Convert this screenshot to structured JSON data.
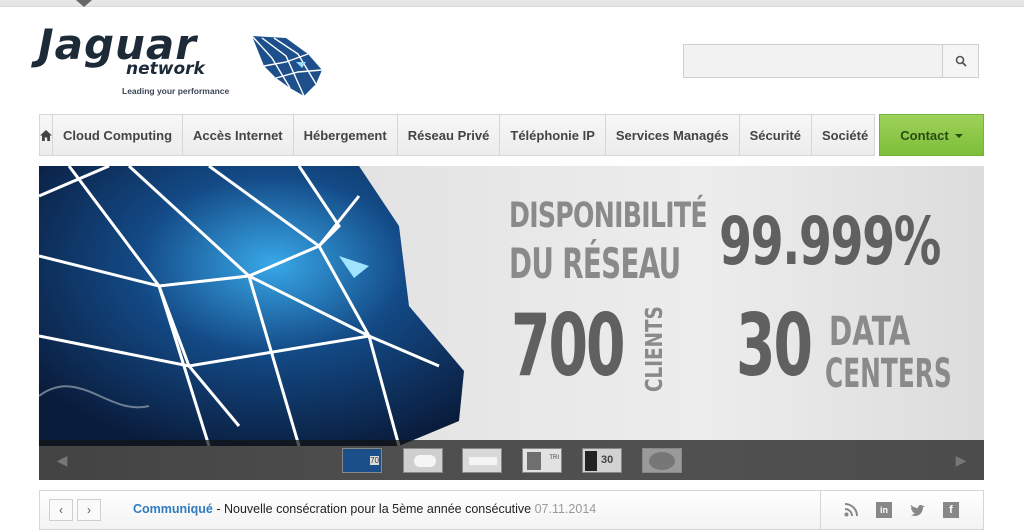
{
  "header": {
    "logo_main": "Jaguar",
    "logo_sub": "network",
    "logo_tagline": "Leading your performance"
  },
  "search": {
    "placeholder": "",
    "icon": "search-icon"
  },
  "nav": {
    "home_icon": "home-icon",
    "items": [
      {
        "label": "Cloud Computing"
      },
      {
        "label": "Accès Internet"
      },
      {
        "label": "Hébergement"
      },
      {
        "label": "Réseau Privé"
      },
      {
        "label": "Téléphonie IP"
      },
      {
        "label": "Services Managés"
      },
      {
        "label": "Sécurité"
      },
      {
        "label": "Société"
      }
    ],
    "contact_label": "Contact",
    "contact_color": "#8cc84b"
  },
  "banner": {
    "label_line1": "DISPONIBILITÉ",
    "label_line2": "DU RÉSEAU",
    "availability": "99.999%",
    "clients_count": "700",
    "clients_label": "CLIENTS",
    "datacenters_count": "30",
    "datacenters_label1": "DATA",
    "datacenters_label2": "CENTERS",
    "thumbs": [
      {
        "text": "70"
      },
      {
        "text": ""
      },
      {
        "text": ""
      },
      {
        "text": "TRI"
      },
      {
        "text": "30"
      },
      {
        "text": ""
      }
    ]
  },
  "news": {
    "label": "Communiqué",
    "separator": " - ",
    "text": "Nouvelle consécration pour la 5ème année consécutive",
    "date": "07.11.2014",
    "social": [
      "rss-icon",
      "linkedin-icon",
      "twitter-icon",
      "facebook-icon"
    ]
  }
}
